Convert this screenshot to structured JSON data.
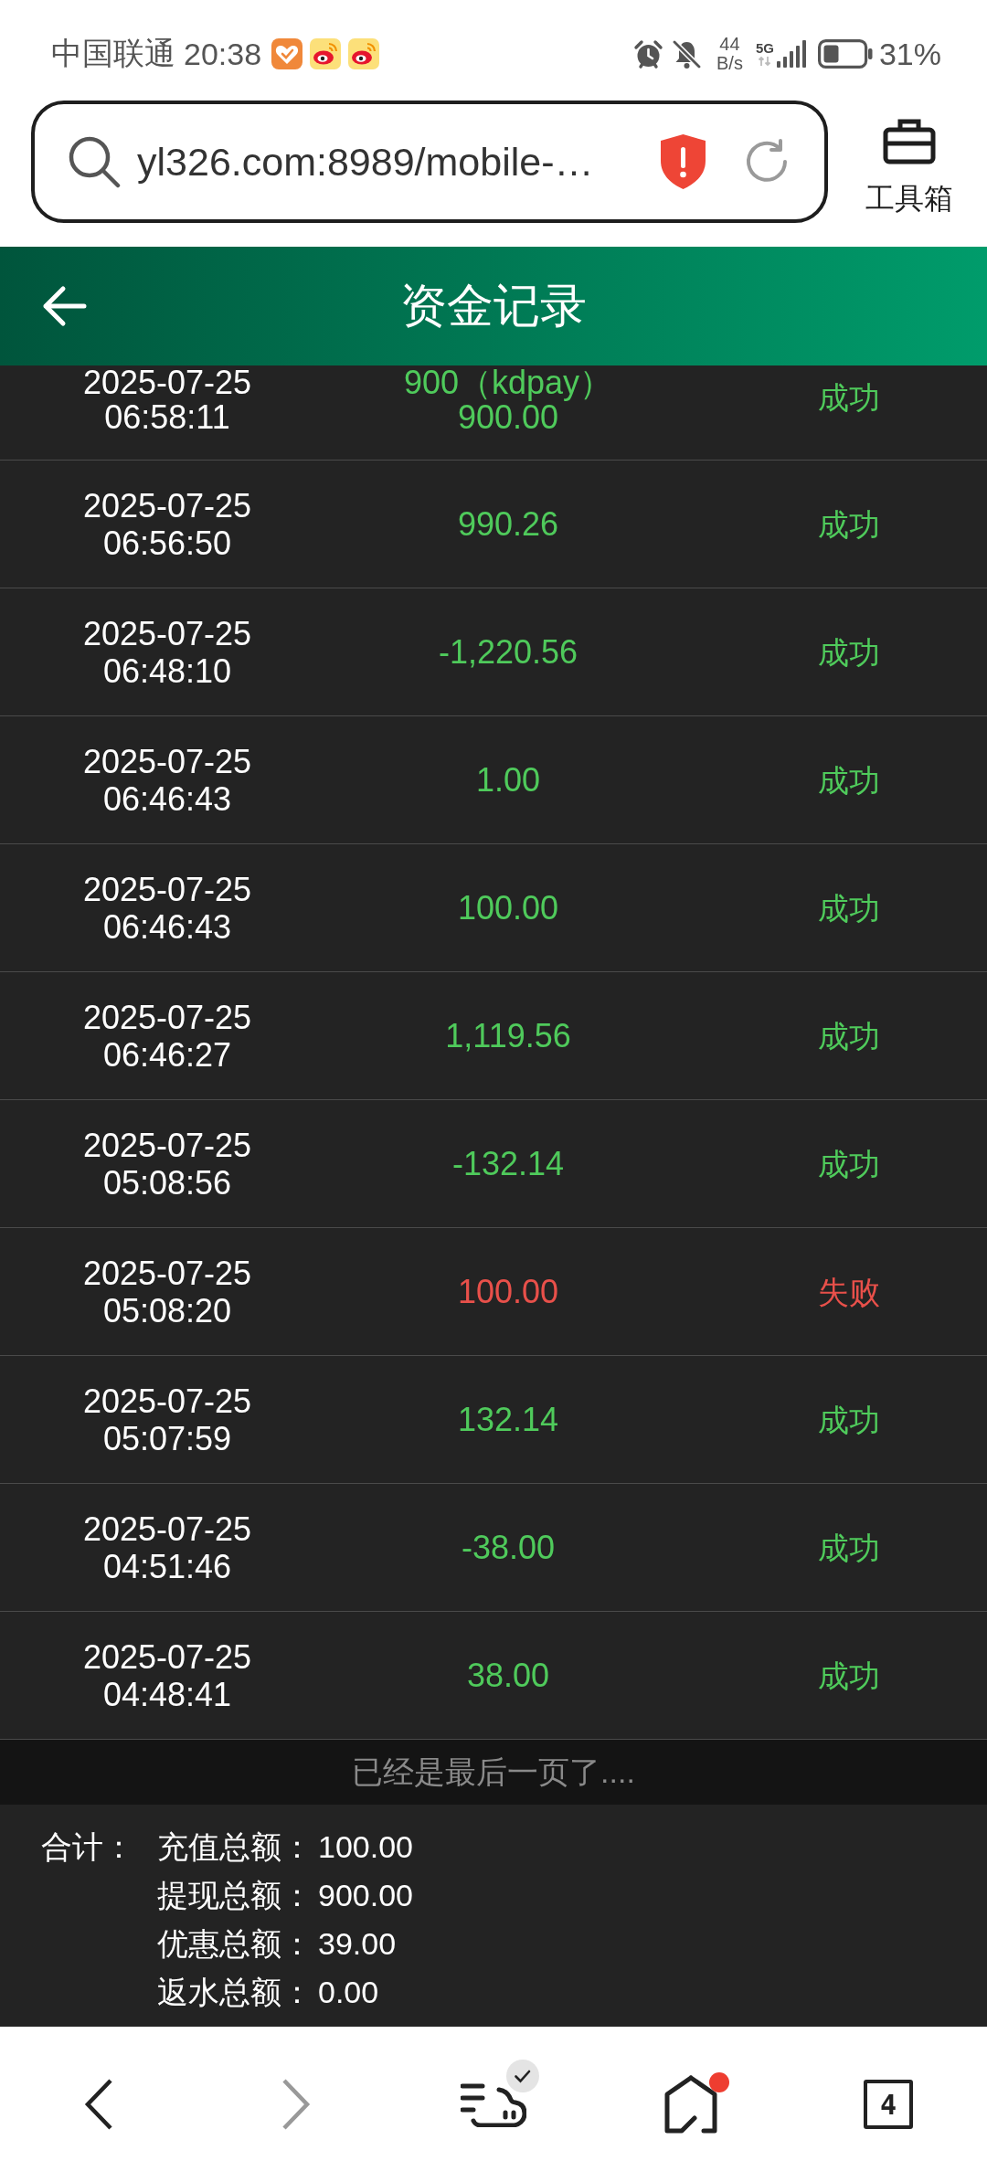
{
  "status_bar": {
    "carrier": "中国联通",
    "time": "20:38",
    "speed_value": "44",
    "speed_unit": "B/s",
    "network": "5G",
    "battery": "31%"
  },
  "browser_bar": {
    "url": "yl326.com:8989/mobile-…",
    "toolbox_label": "工具箱"
  },
  "header": {
    "title": "资金记录"
  },
  "records": [
    {
      "date": "2025-07-25",
      "time": "06:58:11",
      "detail": "900（kdpay）",
      "amount": "900.00",
      "status": "成功",
      "color": "#4fca5b"
    },
    {
      "date": "2025-07-25",
      "time": "06:56:50",
      "amount": "990.26",
      "status": "成功",
      "color": "#4fca5b"
    },
    {
      "date": "2025-07-25",
      "time": "06:48:10",
      "amount": "-1,220.56",
      "status": "成功",
      "color": "#4fca5b"
    },
    {
      "date": "2025-07-25",
      "time": "06:46:43",
      "amount": "1.00",
      "status": "成功",
      "color": "#4fca5b"
    },
    {
      "date": "2025-07-25",
      "time": "06:46:43",
      "amount": "100.00",
      "status": "成功",
      "color": "#4fca5b"
    },
    {
      "date": "2025-07-25",
      "time": "06:46:27",
      "amount": "1,119.56",
      "status": "成功",
      "color": "#4fca5b"
    },
    {
      "date": "2025-07-25",
      "time": "05:08:56",
      "amount": "-132.14",
      "status": "成功",
      "color": "#4fca5b"
    },
    {
      "date": "2025-07-25",
      "time": "05:08:20",
      "amount": "100.00",
      "status": "失败",
      "color": "#e8504a"
    },
    {
      "date": "2025-07-25",
      "time": "05:07:59",
      "amount": "132.14",
      "status": "成功",
      "color": "#4fca5b"
    },
    {
      "date": "2025-07-25",
      "time": "04:51:46",
      "amount": "-38.00",
      "status": "成功",
      "color": "#4fca5b"
    },
    {
      "date": "2025-07-25",
      "time": "04:48:41",
      "amount": "38.00",
      "status": "成功",
      "color": "#4fca5b"
    }
  ],
  "end_note": "已经是最后一页了....",
  "totals": {
    "label": "合计：",
    "items": [
      {
        "label": "充值总额：",
        "value": "100.00"
      },
      {
        "label": "提现总额：",
        "value": "900.00"
      },
      {
        "label": "优惠总额：",
        "value": "39.00"
      },
      {
        "label": "返水总额：",
        "value": "0.00"
      }
    ]
  },
  "bottom_nav": {
    "forward_disabled": true,
    "home_badge": true,
    "tab_count": "4"
  }
}
